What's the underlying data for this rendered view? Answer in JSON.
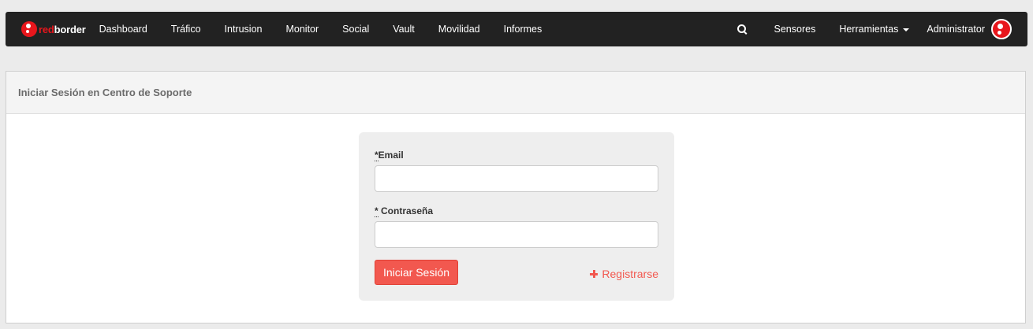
{
  "navbar": {
    "brand": {
      "part1": "red",
      "part2": "border"
    },
    "items": [
      {
        "label": "Dashboard"
      },
      {
        "label": "Tráfico"
      },
      {
        "label": "Intrusion"
      },
      {
        "label": "Monitor"
      },
      {
        "label": "Social"
      },
      {
        "label": "Vault"
      },
      {
        "label": "Movilidad"
      },
      {
        "label": "Informes"
      }
    ],
    "right": {
      "search_icon": "search-icon",
      "sensores": "Sensores",
      "herramientas": "Herramientas",
      "user": "Administrator"
    }
  },
  "panel": {
    "title": "Iniciar Sesión en Centro de Soporte"
  },
  "login": {
    "email_required": "*",
    "email_label": "Email",
    "email_value": "",
    "password_required": "*",
    "password_label": " Contraseña",
    "password_value": "",
    "submit_label": "Iniciar Sesión",
    "register_label": "Registrarse"
  },
  "colors": {
    "navbar_bg": "#222222",
    "brand_red": "#e8161c",
    "accent": "#f2584f"
  }
}
